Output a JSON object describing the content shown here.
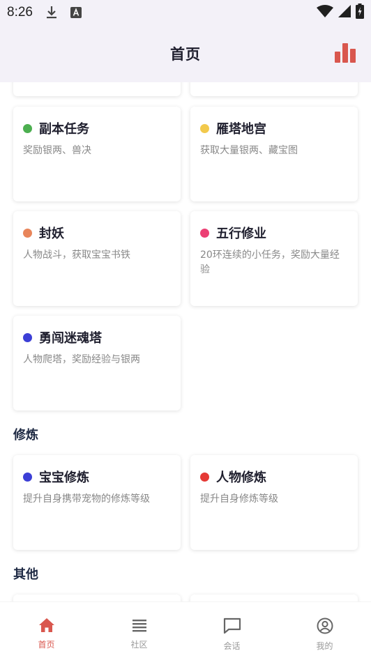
{
  "status_bar": {
    "time": "8:26",
    "icons": [
      "download-icon",
      "a-font-icon",
      "wifi-icon",
      "signal-icon",
      "battery-charging-icon"
    ]
  },
  "header": {
    "title": "首页",
    "action_icon": "bar-chart-icon",
    "accent": "#d9574e"
  },
  "tasks": [
    {
      "name": "副本任务",
      "desc": "奖励银两、兽决",
      "dot": "#4caf50"
    },
    {
      "name": "雁塔地宫",
      "desc": "获取大量银两、藏宝图",
      "dot": "#f2c94c"
    },
    {
      "name": "封妖",
      "desc": "人物战斗，获取宝宝书铁",
      "dot": "#e8855a"
    },
    {
      "name": "五行修业",
      "desc": "20环连续的小任务，奖励大量经验",
      "dot": "#ec3f74"
    },
    {
      "name": "勇闯迷魂塔",
      "desc": "人物爬塔，奖励经验与银两",
      "dot": "#3c3fd6"
    }
  ],
  "sections": {
    "cultivation": "修炼",
    "other": "其他"
  },
  "cultivation": [
    {
      "name": "宝宝修炼",
      "desc": "提升自身携带宠物的修炼等级",
      "dot": "#3c3fd6"
    },
    {
      "name": "人物修炼",
      "desc": "提升自身修炼等级",
      "dot": "#e53935"
    }
  ],
  "bottom_nav": [
    {
      "label": "首页",
      "icon": "home-icon",
      "active": true
    },
    {
      "label": "社区",
      "icon": "list-icon",
      "active": false
    },
    {
      "label": "会话",
      "icon": "chat-icon",
      "active": false
    },
    {
      "label": "我的",
      "icon": "profile-icon",
      "active": false
    }
  ]
}
